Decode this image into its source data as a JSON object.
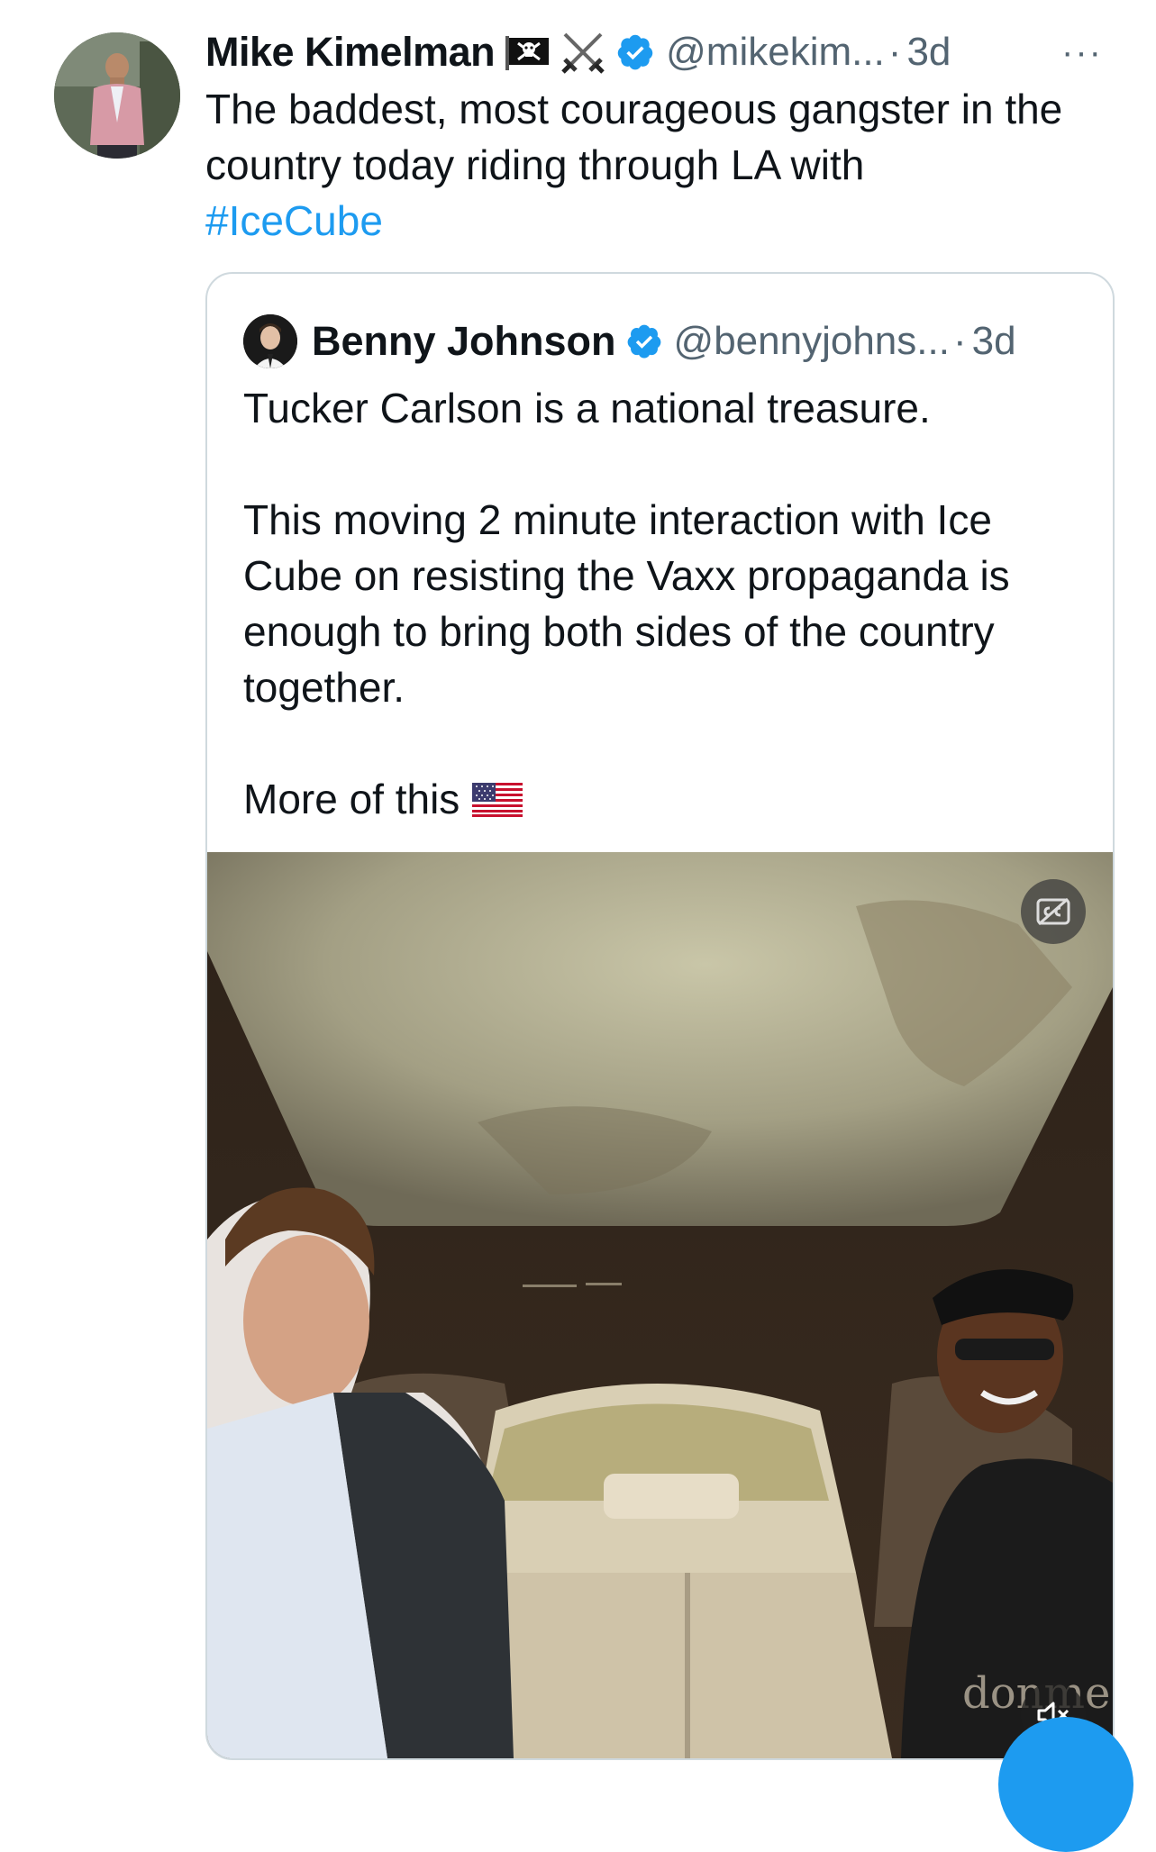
{
  "tweet": {
    "author_name": "Mike Kimelman",
    "author_emojis": [
      "pirate-flag",
      "crossed-swords"
    ],
    "verified": true,
    "handle": "@mikekim...",
    "separator": "·",
    "time": "3d",
    "more": "···",
    "text": "The baddest, most courageous gangster in the country today riding through LA with",
    "hashtag": "#IceCube"
  },
  "quote": {
    "author_name": "Benny Johnson",
    "verified": true,
    "handle": "@bennyjohns...",
    "separator": "·",
    "time": "3d",
    "paragraphs": [
      "Tucker Carlson is a national treasure.",
      "This moving 2 minute interaction with Ice Cube on resisting the Vaxx propaganda is enough to bring both sides of the country together.",
      "More of this"
    ],
    "trailing_emoji": "us-flag",
    "media": {
      "type": "video",
      "shirt_text": "donme",
      "captions_icon": "closed-captions-icon",
      "mute_icon": "speaker-muted-icon"
    }
  },
  "colors": {
    "accent": "#1d9bf0",
    "text": "#0f1419",
    "secondary": "#536471",
    "border": "#cfd9de"
  }
}
